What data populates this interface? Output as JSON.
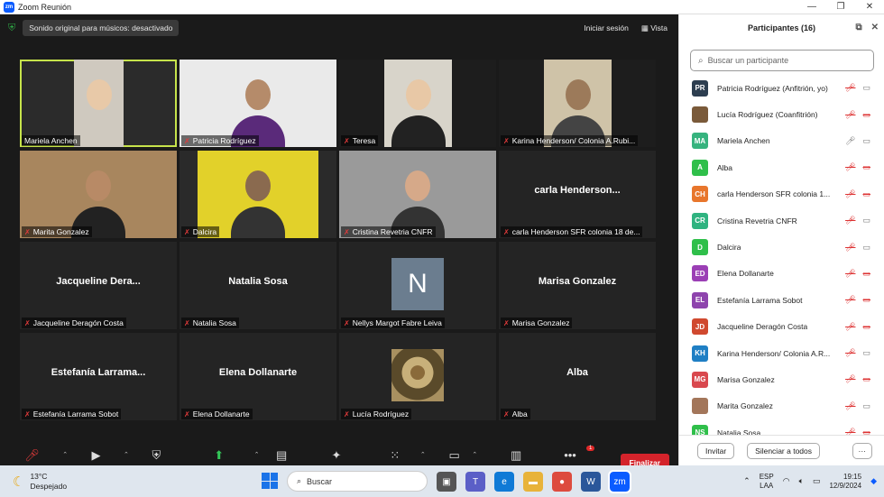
{
  "window": {
    "title": "Zoom Reunión",
    "controls": [
      "minimize-icon",
      "maximize-icon",
      "close-icon"
    ]
  },
  "topbar": {
    "audio_status": "Sonido original para músicos: desactivado",
    "sign_in": "Iniciar sesión",
    "view": "Vista"
  },
  "tiles": [
    {
      "name": "Mariela Anchen",
      "big": "",
      "muted": false,
      "video": true,
      "active": true
    },
    {
      "name": "Patricia Rodríguez",
      "big": "",
      "muted": true,
      "video": true
    },
    {
      "name": "Teresa",
      "big": "",
      "muted": true,
      "video": true
    },
    {
      "name": "Karina Henderson/ Colonia A.Rubi...",
      "big": "",
      "muted": true,
      "video": true
    },
    {
      "name": "Marita Gonzalez",
      "big": "",
      "muted": true,
      "video": true
    },
    {
      "name": "Dalcira",
      "big": "",
      "muted": true,
      "video": true
    },
    {
      "name": "Cristina Revetria CNFR",
      "big": "",
      "muted": true,
      "video": true
    },
    {
      "name": "carla Henderson SFR colonia 18 de...",
      "big": "carla  Henderson...",
      "muted": true,
      "video": false
    },
    {
      "name": "Jacqueline Deragón Costa",
      "big": "Jacqueline  Dera...",
      "muted": true,
      "video": false
    },
    {
      "name": "Natalia Sosa",
      "big": "Natalia Sosa",
      "muted": true,
      "video": false
    },
    {
      "name": "Nellys Margot Fabre Leiva",
      "big": "",
      "muted": true,
      "video": false,
      "avatar": "N"
    },
    {
      "name": "Marisa Gonzalez",
      "big": "Marisa Gonzalez",
      "muted": true,
      "video": false
    },
    {
      "name": "Estefanía Larrama Sobot",
      "big": "Estefanía  Larrama...",
      "muted": true,
      "video": false
    },
    {
      "name": "Elena Dollanarte",
      "big": "Elena Dollanarte",
      "muted": true,
      "video": false
    },
    {
      "name": "Lucía Rodríguez",
      "big": "",
      "muted": true,
      "video": false,
      "tree": true
    },
    {
      "name": "Alba",
      "big": "Alba",
      "muted": true,
      "video": false
    }
  ],
  "toolbar": [
    {
      "label": "Reactivar audio",
      "icon": "mic-off-icon",
      "caret": true
    },
    {
      "label": "Detener video",
      "icon": "video-camera-icon",
      "caret": true
    },
    {
      "label": "Seguridad",
      "icon": "shield-icon",
      "caret": false
    },
    {
      "label": "Compartir pantalla",
      "icon": "share-screen-icon",
      "caret": true,
      "green": true
    },
    {
      "label": "Resumen",
      "icon": "summary-icon",
      "caret": false
    },
    {
      "label": "AI Companion",
      "icon": "sparkle-icon",
      "caret": false
    },
    {
      "label": "Aplicaciones",
      "icon": "apps-icon",
      "caret": true
    },
    {
      "label": "Pizarras",
      "icon": "whiteboard-icon",
      "caret": true
    },
    {
      "label": "Notas",
      "icon": "notes-icon",
      "caret": false
    },
    {
      "label": "Más",
      "icon": "more-icon",
      "caret": false,
      "badge": "1"
    }
  ],
  "end_button": "Finalizar",
  "panel": {
    "title": "Participantes (16)",
    "search_placeholder": "Buscar un participante",
    "invite": "Invitar",
    "mute_all": "Silenciar a todos",
    "more": "···",
    "participants": [
      {
        "initials": "PR",
        "color": "#2d3e50",
        "name": "Patricia Rodríguez (Anfitrión, yo)",
        "mic": "off",
        "cam": "on"
      },
      {
        "initials": "",
        "color": "#7a5a3a",
        "name": "Lucía Rodríguez (Coanfitrión)",
        "mic": "off",
        "cam": "off",
        "photo": true
      },
      {
        "initials": "MA",
        "color": "#36b37e",
        "name": "Mariela Anchen",
        "mic": "on",
        "cam": "on"
      },
      {
        "initials": "A",
        "color": "#2fbf4a",
        "name": "Alba",
        "mic": "off",
        "cam": "off"
      },
      {
        "initials": "CH",
        "color": "#e8762c",
        "name": "carla Henderson SFR colonia 1...",
        "mic": "off",
        "cam": "off"
      },
      {
        "initials": "CR",
        "color": "#2fb380",
        "name": "Cristina Revetria CNFR",
        "mic": "off",
        "cam": "on"
      },
      {
        "initials": "D",
        "color": "#2fbf4a",
        "name": "Dalcira",
        "mic": "off",
        "cam": "on"
      },
      {
        "initials": "ED",
        "color": "#9b3fb5",
        "name": "Elena Dollanarte",
        "mic": "off",
        "cam": "off"
      },
      {
        "initials": "EL",
        "color": "#8e44ad",
        "name": "Estefanía Larrama Sobot",
        "mic": "off",
        "cam": "off"
      },
      {
        "initials": "JD",
        "color": "#d0492f",
        "name": "Jacqueline Deragón Costa",
        "mic": "off",
        "cam": "off"
      },
      {
        "initials": "KH",
        "color": "#1f7fc4",
        "name": "Karina Henderson/ Colonia A.R...",
        "mic": "off",
        "cam": "on"
      },
      {
        "initials": "MG",
        "color": "#d9484e",
        "name": "Marisa Gonzalez",
        "mic": "off",
        "cam": "off"
      },
      {
        "initials": "",
        "color": "#a3765a",
        "name": "Marita Gonzalez",
        "mic": "off",
        "cam": "on",
        "photo": true
      },
      {
        "initials": "NS",
        "color": "#2fbf4a",
        "name": "Natalia Sosa",
        "mic": "off",
        "cam": "off"
      }
    ]
  },
  "taskbar": {
    "temp": "13°C",
    "weather": "Despejado",
    "search": "Buscar",
    "lang1": "ESP",
    "lang2": "LAA",
    "time": "19:15",
    "date": "12/9/2024"
  }
}
